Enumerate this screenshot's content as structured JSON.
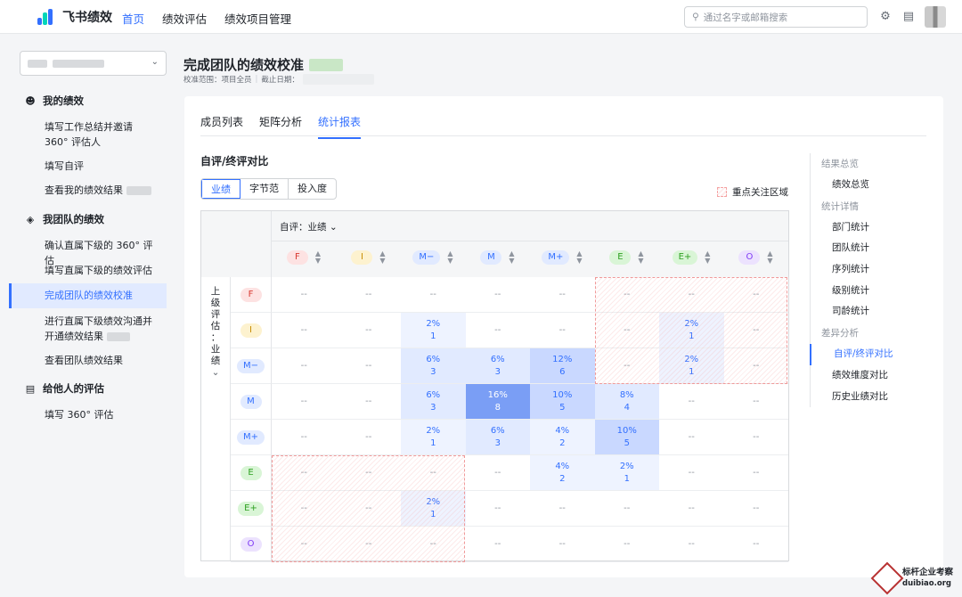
{
  "topbar": {
    "brand": "飞书绩效",
    "nav": [
      "首页",
      "绩效评估",
      "绩效项目管理"
    ],
    "active_nav": 0,
    "search_placeholder": "通过名字或邮箱搜索",
    "brand_color": "#3370ff"
  },
  "sidebar": {
    "sections": [
      {
        "icon": "person-icon",
        "title": "我的绩效",
        "items": [
          "填写工作总结并邀请 360° 评估人",
          "填写自评",
          "查看我的绩效结果"
        ]
      },
      {
        "icon": "layers-icon",
        "title": "我团队的绩效",
        "items": [
          "确认直属下级的 360° 评估",
          "填写直属下级的绩效评估",
          "完成团队的绩效校准",
          "进行直属下级绩效沟通并开通绩效结果",
          "查看团队绩效结果"
        ]
      },
      {
        "icon": "clipboard-icon",
        "title": "给他人的评估",
        "items": [
          "填写 360° 评估"
        ]
      }
    ],
    "active": "完成团队的绩效校准"
  },
  "header": {
    "title": "完成团队的绩效校准",
    "scope_label": "校准范围：项目全员",
    "deadline_label": "截止日期："
  },
  "tabs": [
    "成员列表",
    "矩阵分析",
    "统计报表"
  ],
  "active_tab": 2,
  "report": {
    "title": "自评/终评对比",
    "segments": [
      "业绩",
      "字节范",
      "投入度"
    ],
    "active_segment": 0,
    "legend": "重点关注区域",
    "dropdown": "自评：业绩",
    "row_axis": [
      "上",
      "级",
      "评",
      "估",
      "：",
      "业",
      "绩"
    ],
    "levels": [
      {
        "label": "F",
        "color": "#fde2e2",
        "text": "#d83931"
      },
      {
        "label": "I",
        "color": "#fdf2cf",
        "text": "#c78b00"
      },
      {
        "label": "M−",
        "color": "#e1eaff",
        "text": "#3370ff"
      },
      {
        "label": "M",
        "color": "#e1eaff",
        "text": "#3370ff"
      },
      {
        "label": "M+",
        "color": "#e1eaff",
        "text": "#3370ff"
      },
      {
        "label": "E",
        "color": "#d9f5d6",
        "text": "#2ea121"
      },
      {
        "label": "E+",
        "color": "#d9f5d6",
        "text": "#2ea121"
      },
      {
        "label": "O",
        "color": "#ece2fe",
        "text": "#7f3bf5"
      }
    ],
    "matrix": [
      [
        null,
        null,
        null,
        null,
        null,
        null,
        null,
        null
      ],
      [
        null,
        null,
        {
          "p": "2%",
          "n": "1"
        },
        null,
        null,
        null,
        {
          "p": "2%",
          "n": "1"
        },
        null
      ],
      [
        null,
        null,
        {
          "p": "6%",
          "n": "3"
        },
        {
          "p": "6%",
          "n": "3"
        },
        {
          "p": "12%",
          "n": "6"
        },
        null,
        {
          "p": "2%",
          "n": "1"
        },
        null
      ],
      [
        null,
        null,
        {
          "p": "6%",
          "n": "3"
        },
        {
          "p": "16%",
          "n": "8"
        },
        {
          "p": "10%",
          "n": "5"
        },
        {
          "p": "8%",
          "n": "4"
        },
        null,
        null
      ],
      [
        null,
        null,
        {
          "p": "2%",
          "n": "1"
        },
        {
          "p": "6%",
          "n": "3"
        },
        {
          "p": "4%",
          "n": "2"
        },
        {
          "p": "10%",
          "n": "5"
        },
        null,
        null
      ],
      [
        null,
        null,
        null,
        null,
        {
          "p": "4%",
          "n": "2"
        },
        {
          "p": "2%",
          "n": "1"
        },
        null,
        null
      ],
      [
        null,
        null,
        {
          "p": "2%",
          "n": "1"
        },
        null,
        null,
        null,
        null,
        null
      ],
      [
        null,
        null,
        null,
        null,
        null,
        null,
        null,
        null
      ]
    ],
    "empty": "--"
  },
  "right_nav": [
    {
      "group": "结果总览",
      "items": [
        "绩效总览"
      ]
    },
    {
      "group": "统计详情",
      "items": [
        "部门统计",
        "团队统计",
        "序列统计",
        "级别统计",
        "司龄统计"
      ]
    },
    {
      "group": "差异分析",
      "items": [
        "自评/终评对比",
        "绩效维度对比",
        "历史业绩对比"
      ]
    }
  ],
  "right_nav_active": "自评/终评对比",
  "watermark": {
    "line1": "标杆企业考察",
    "line2": "duibiao.org"
  }
}
